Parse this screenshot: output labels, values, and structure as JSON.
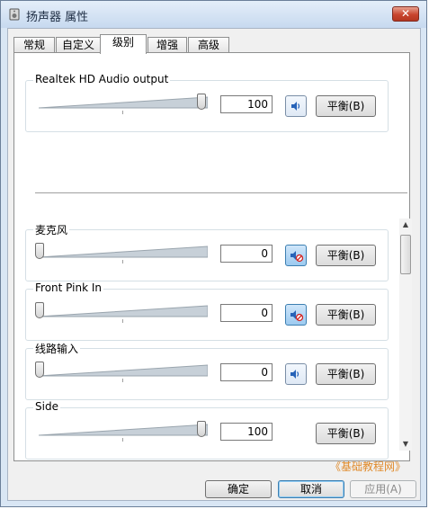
{
  "window": {
    "title": "扬声器 属性",
    "close_label": "✕"
  },
  "tabs": [
    {
      "label": "常规",
      "active": false
    },
    {
      "label": "自定义",
      "active": false
    },
    {
      "label": "级别",
      "active": true
    },
    {
      "label": "增强",
      "active": false
    },
    {
      "label": "高级",
      "active": false
    }
  ],
  "master": {
    "name": "Realtek HD Audio output",
    "level": 100,
    "value": "100",
    "muted": false,
    "balance_label": "平衡(B)"
  },
  "channels": [
    {
      "name": "麦克风",
      "level": 0,
      "value": "0",
      "muted": true,
      "has_speaker": true,
      "balance_label": "平衡(B)"
    },
    {
      "name": "Front Pink In",
      "level": 0,
      "value": "0",
      "muted": true,
      "has_speaker": true,
      "balance_label": "平衡(B)"
    },
    {
      "name": "线路输入",
      "level": 0,
      "value": "0",
      "muted": false,
      "has_speaker": true,
      "balance_label": "平衡(B)"
    },
    {
      "name": "Side",
      "level": 100,
      "value": "100",
      "muted": false,
      "has_speaker": false,
      "balance_label": "平衡(B)"
    }
  ],
  "watermark": "《基础教程网》",
  "buttons": {
    "ok": "确定",
    "cancel": "取消",
    "apply": "应用(A)"
  },
  "colors": {
    "muted_fill": "#9ccaf0",
    "watermark": "#e08a2a"
  }
}
